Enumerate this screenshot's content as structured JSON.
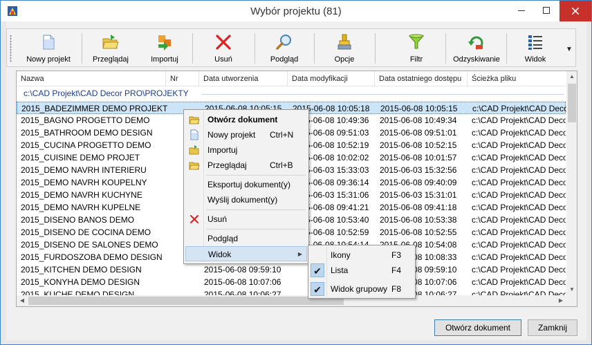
{
  "window": {
    "title": "Wybór projektu (81)"
  },
  "toolbar": {
    "buttons": [
      {
        "label": "Nowy projekt",
        "icon": "new-document-icon"
      },
      {
        "label": "Przeglądaj",
        "icon": "browse-folder-icon"
      },
      {
        "label": "Importuj",
        "icon": "import-icon"
      },
      {
        "label": "Usuń",
        "icon": "delete-x-icon"
      },
      {
        "label": "Podgląd",
        "icon": "magnifier-icon"
      },
      {
        "label": "Opcje",
        "icon": "options-icon"
      },
      {
        "label": "Filtr",
        "icon": "funnel-icon"
      },
      {
        "label": "Odzyskiwanie",
        "icon": "recovery-icon"
      },
      {
        "label": "Widok",
        "icon": "view-list-icon"
      }
    ]
  },
  "list": {
    "columns": [
      "Nazwa",
      "Nr",
      "Data utworzenia",
      "Data modyfikacji",
      "Data ostatniego dostępu",
      "Ścieżka pliku"
    ],
    "group_header": "c:\\CAD Projekt\\CAD Decor PRO\\PROJEKTY",
    "rows": [
      {
        "name": "2015_BADEZIMMER DEMO PROJEKT",
        "created": "2015-06-08 10:05:15",
        "modified": "2015-06-08 10:05:18",
        "accessed": "2015-06-08 10:05:15",
        "path": "c:\\CAD Projekt\\CAD Decor PRO\\PROJEKTY"
      },
      {
        "name": "2015_BAGNO PROGETTO DEMO",
        "created": "",
        "modified": "2015-06-08 10:49:36",
        "accessed": "2015-06-08 10:49:34",
        "path": "c:\\CAD Projekt\\CAD Decor PRO\\PROJEKTY"
      },
      {
        "name": "2015_BATHROOM DEMO DESIGN",
        "created": "",
        "modified": "2015-06-08 09:51:03",
        "accessed": "2015-06-08 09:51:01",
        "path": "c:\\CAD Projekt\\CAD Decor PRO\\PROJEKTY"
      },
      {
        "name": "2015_CUCINA PROGETTO DEMO",
        "created": "",
        "modified": "2015-06-08 10:52:19",
        "accessed": "2015-06-08 10:52:15",
        "path": "c:\\CAD Projekt\\CAD Decor PRO\\PROJEKTY"
      },
      {
        "name": "2015_CUISINE DEMO PROJET",
        "created": "",
        "modified": "2015-06-08 10:02:02",
        "accessed": "2015-06-08 10:01:57",
        "path": "c:\\CAD Projekt\\CAD Decor PRO\\PROJEKTY"
      },
      {
        "name": "2015_DEMO NAVRH INTERIERU",
        "created": "",
        "modified": "2015-06-03 15:33:03",
        "accessed": "2015-06-03 15:32:56",
        "path": "c:\\CAD Projekt\\CAD Decor PRO\\PROJEKTY"
      },
      {
        "name": "2015_DEMO NAVRH KOUPELNY",
        "created": "",
        "modified": "2015-06-08 09:36:14",
        "accessed": "2015-06-08 09:40:09",
        "path": "c:\\CAD Projekt\\CAD Decor PRO\\PROJEKTY"
      },
      {
        "name": "2015_DEMO NAVRH KUCHYNE",
        "created": "",
        "modified": "2015-06-03 15:31:06",
        "accessed": "2015-06-03 15:31:01",
        "path": "c:\\CAD Projekt\\CAD Decor PRO\\PROJEKTY"
      },
      {
        "name": "2015_DEMO NAVRH KUPELNE",
        "created": "",
        "modified": "2015-06-08 09:41:21",
        "accessed": "2015-06-08 09:41:18",
        "path": "c:\\CAD Projekt\\CAD Decor PRO\\PROJEKTY"
      },
      {
        "name": "2015_DISENO BANOS DEMO",
        "created": "",
        "modified": "2015-06-08 10:53:40",
        "accessed": "2015-06-08 10:53:38",
        "path": "c:\\CAD Projekt\\CAD Decor PRO\\PROJEKTY"
      },
      {
        "name": "2015_DISENO DE COCINA DEMO",
        "created": "",
        "modified": "2015-06-08 10:52:59",
        "accessed": "2015-06-08 10:52:55",
        "path": "c:\\CAD Projekt\\CAD Decor PRO\\PROJEKTY"
      },
      {
        "name": "2015_DISENO DE SALONES DEMO",
        "created": "",
        "modified": "2015-06-08 10:54:14",
        "accessed": "2015-06-08 10:54:08",
        "path": "c:\\CAD Projekt\\CAD Decor PRO\\PROJEKTY"
      },
      {
        "name": "2015_FURDOSZOBA DEMO DESIGN",
        "created": "",
        "modified": "",
        "accessed": "2015-06-08 10:08:33",
        "path": "c:\\CAD Projekt\\CAD Decor PRO\\PROJEKTY"
      },
      {
        "name": "2015_KITCHEN DEMO DESIGN",
        "created": "2015-06-08 09:59:10",
        "modified": "",
        "accessed": "2015-06-08 09:59:10",
        "path": "c:\\CAD Projekt\\CAD Decor PRO\\PROJEKTY"
      },
      {
        "name": "2015_KONYHA DEMO DESIGN",
        "created": "2015-06-08 10:07:06",
        "modified": "",
        "accessed": "2015-06-08 10:07:06",
        "path": "c:\\CAD Projekt\\CAD Decor PRO\\PROJEKTY"
      },
      {
        "name": "2015_KUCHE DEMO DESIGN",
        "created": "2015-06-08 10:06:27",
        "modified": "",
        "accessed": "2015-06-08 10:06:27",
        "path": "c:\\CAD Projekt\\CAD Decor PRO\\PROJEKTY"
      }
    ]
  },
  "context_menu": {
    "open": "Otwórz dokument",
    "new_project": "Nowy projekt",
    "new_project_sc": "Ctrl+N",
    "import": "Importuj",
    "browse": "Przeglądaj",
    "browse_sc": "Ctrl+B",
    "export": "Eksportuj dokument(y)",
    "send": "Wyślij dokument(y)",
    "delete": "Usuń",
    "preview": "Podgląd",
    "view": "Widok"
  },
  "submenu": {
    "icons": "Ikony",
    "icons_sc": "F3",
    "list": "Lista",
    "list_sc": "F4",
    "group": "Widok grupowy",
    "group_sc": "F8"
  },
  "footer": {
    "open_button": "Otwórz dokument",
    "close_button": "Zamknij"
  },
  "colors": {
    "selection": "#cce4f7",
    "group_header": "#1c3c8c",
    "close_button": "#c7302b"
  }
}
